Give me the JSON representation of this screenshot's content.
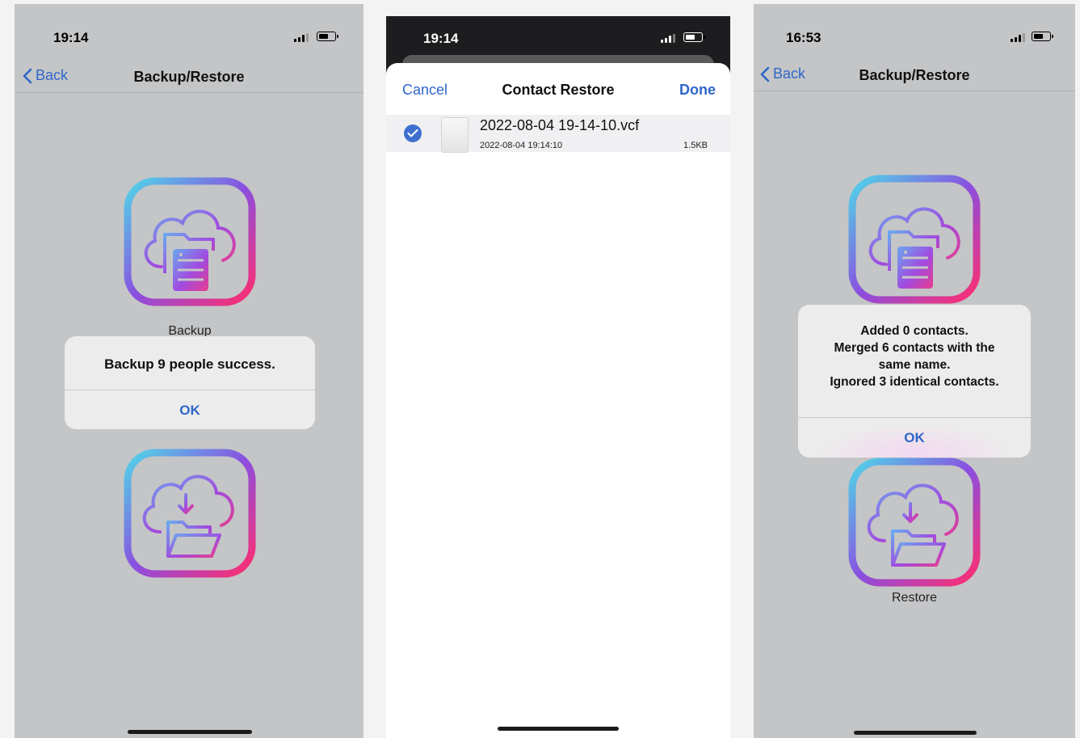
{
  "screens": [
    {
      "status_time": "19:14",
      "back_label": "Back",
      "title": "Backup/Restore",
      "backup_label": "Backup",
      "alert": {
        "message": "Backup 9 people success.",
        "ok_label": "OK"
      }
    },
    {
      "status_time": "19:14",
      "sheet": {
        "cancel_label": "Cancel",
        "title": "Contact Restore",
        "done_label": "Done",
        "file": {
          "name": "2022-08-04 19-14-10.vcf",
          "date": "2022-08-04 19:14:10",
          "size": "1.5KB",
          "selected": true
        }
      }
    },
    {
      "status_time": "16:53",
      "back_label": "Back",
      "title": "Backup/Restore",
      "restore_label": "Restore",
      "alert": {
        "lines": [
          "Added 0 contacts.",
          "Merged 6 contacts with the",
          "same name.",
          "Ignored 3 identical contacts."
        ],
        "ok_label": "OK"
      }
    }
  ],
  "icons": {
    "backup": "cloud-folder-server-icon",
    "restore": "cloud-download-folder-icon",
    "back": "chevron-left-icon",
    "check": "checkmark-circle-icon",
    "signal": "cellular-signal-icon",
    "battery": "battery-icon"
  },
  "colors": {
    "ios_blue": "#2f66c9",
    "gradient_cyan": "#4fd6e8",
    "gradient_purple": "#8a4fe0",
    "gradient_pink": "#ff2d6f",
    "screen_gray": "#c4c5c7"
  }
}
